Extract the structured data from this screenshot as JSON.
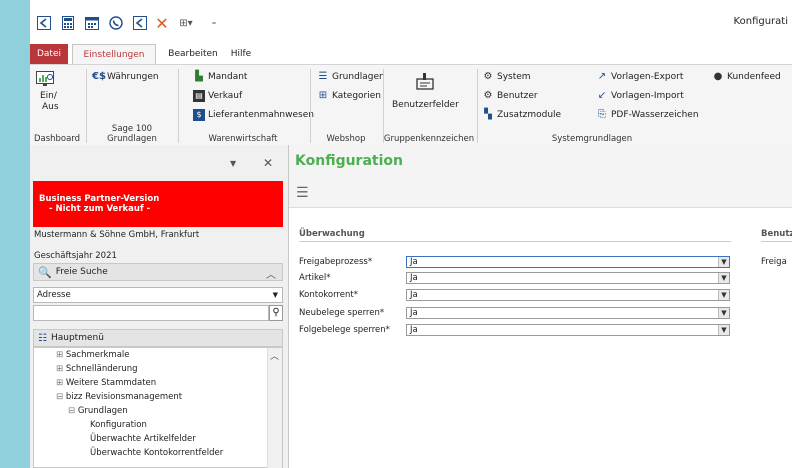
{
  "window": {
    "title": "Konfigurati"
  },
  "tabs": {
    "datei": "Datei",
    "einstellungen": "Einstellungen",
    "bearbeiten": "Bearbeiten",
    "hilfe": "Hilfe"
  },
  "ribbon": {
    "ein_aus_1": "Ein/",
    "ein_aus_2": "Aus",
    "waehrungen": "Währungen",
    "mandant": "Mandant",
    "verkauf": "Verkauf",
    "lieferantenmahnwesen": "Lieferantenmahnwesen",
    "grundlagen": "Grundlagen",
    "kategorien": "Kategorien",
    "benutzerfelder": "Benutzerfelder",
    "system": "System",
    "benutzer": "Benutzer",
    "zusatzmodule": "Zusatzmodule",
    "vorlagen_export": "Vorlagen-Export",
    "vorlagen_import": "Vorlagen-Import",
    "pdf_wasserzeichen": "PDF-Wasserzeichen",
    "kundenfeed": "Kundenfeed",
    "groups": {
      "dashboard": "Dashboard",
      "sage": "Sage 100 Grundlagen",
      "warenwirtschaft": "Warenwirtschaft",
      "webshop": "Webshop",
      "gruppenkennzeichen": "Gruppenkennzeichen",
      "systemgrundlagen": "Systemgrundlagen"
    }
  },
  "left": {
    "bp_line1": "Business Partner-Version",
    "bp_line2": "- Nicht zum Verkauf -",
    "company": "Mustermann & Söhne GmbH, Frankfurt",
    "fiscal_year": "Geschäftsjahr 2021",
    "search_header": "Freie Suche",
    "search_scope": "Adresse",
    "search_value": "",
    "menu_header": "Hauptmenü",
    "tree": [
      "Sachmerkmale",
      "Schnelländerung",
      "Weitere Stammdaten",
      "bizz Revisionsmanagement",
      "Grundlagen",
      "Konfiguration",
      "Überwachte Artikelfelder",
      "Überwachte Kontokorrentfelder"
    ]
  },
  "main": {
    "title": "Konfiguration",
    "section_ueberwachung": "Überwachung",
    "section_benutzer": "Benutze",
    "right_label": "Freiga",
    "fields": [
      {
        "label": "Freigabeprozess*",
        "value": "Ja"
      },
      {
        "label": "Artikel*",
        "value": "Ja"
      },
      {
        "label": "Kontokorrent*",
        "value": "Ja"
      },
      {
        "label": "Neubelege sperren*",
        "value": "Ja"
      },
      {
        "label": "Folgebelege sperren*",
        "value": "Ja"
      }
    ]
  },
  "icons": [
    "back-icon",
    "calculator-icon",
    "calendar-icon",
    "phone-icon",
    "close-x-icon",
    "customize-icon",
    "menu-hamburger-icon",
    "search-icon",
    "chevron-down-icon",
    "close-icon"
  ]
}
